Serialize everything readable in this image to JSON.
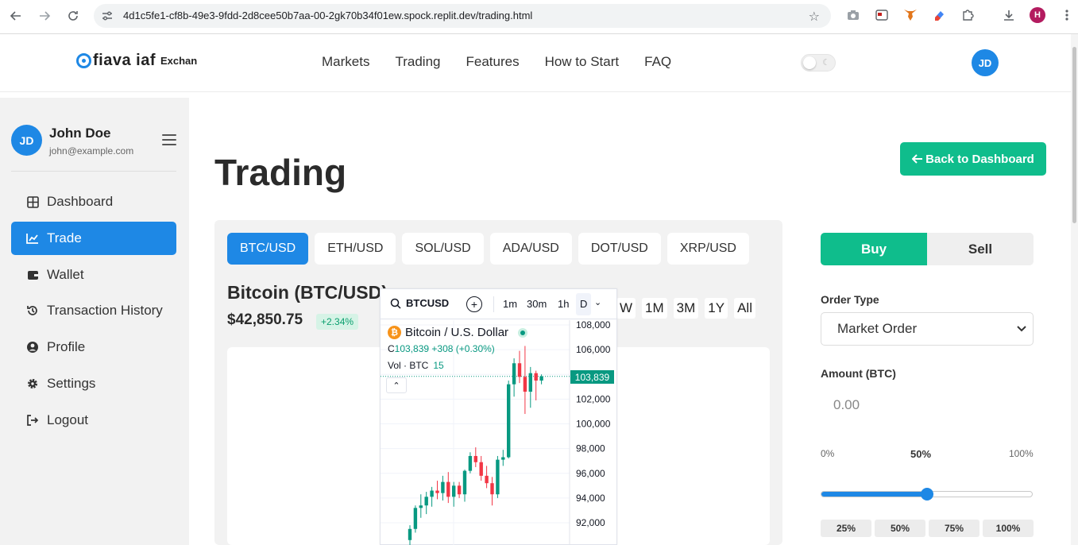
{
  "browser": {
    "url": "4d1c5fe1-cf8b-49e3-9fdd-2d8cee50b7aa-00-2gk70b34f01ew.spock.replit.dev/trading.html",
    "profile_initial": "H"
  },
  "header": {
    "logo_text": "fiava iaf",
    "logo_sub": "Exchan",
    "nav": [
      "Markets",
      "Trading",
      "Features",
      "How to Start",
      "FAQ"
    ],
    "avatar_initials": "JD"
  },
  "sidebar": {
    "user": {
      "initials": "JD",
      "name": "John Doe",
      "email": "john@example.com"
    },
    "items": [
      {
        "label": "Dashboard",
        "icon": "grid-icon",
        "active": false
      },
      {
        "label": "Trade",
        "icon": "chart-line-icon",
        "active": true
      },
      {
        "label": "Wallet",
        "icon": "wallet-icon",
        "active": false
      },
      {
        "label": "Transaction History",
        "icon": "history-icon",
        "active": false
      },
      {
        "label": "Profile",
        "icon": "user-circle-icon",
        "active": false
      },
      {
        "label": "Settings",
        "icon": "gear-icon",
        "active": false
      },
      {
        "label": "Logout",
        "icon": "logout-icon",
        "active": false
      }
    ]
  },
  "main": {
    "title": "Trading",
    "back_button": "Back to Dashboard",
    "pairs": [
      "BTC/USD",
      "ETH/USD",
      "SOL/USD",
      "ADA/USD",
      "DOT/USD",
      "XRP/USD"
    ],
    "active_pair": "BTC/USD",
    "asset_name": "Bitcoin (BTC/USD)",
    "asset_price": "$42,850.75",
    "asset_change": "+2.34%",
    "ranges": [
      "W",
      "1M",
      "3M",
      "1Y",
      "All"
    ]
  },
  "widget": {
    "symbol": "BTCUSD",
    "intervals": [
      "1m",
      "30m",
      "1h",
      "D"
    ],
    "active_interval": "D",
    "title": "Bitcoin / U.S. Dollar",
    "btc_glyph": "₿",
    "ohlc_prefix": "C",
    "ohlc_close": "103,839",
    "ohlc_change": "+308 (+0.30%)",
    "vol_label": "Vol · BTC",
    "vol_value": "15",
    "current_price_label": "103,839",
    "colors": {
      "up": "#089981",
      "down": "#f23645"
    }
  },
  "chart_data": {
    "type": "candlestick",
    "y_ticks": [
      108000,
      106000,
      104000,
      102000,
      100000,
      98000,
      96000,
      94000,
      92000
    ],
    "y_tick_labels": [
      "108,000",
      "106,000",
      "",
      "102,000",
      "100,000",
      "98,000",
      "96,000",
      "94,000",
      "92,000"
    ],
    "last_price": 103839,
    "candles": [
      {
        "o": 90600,
        "h": 91800,
        "l": 90000,
        "c": 91500
      },
      {
        "o": 91500,
        "h": 93400,
        "l": 91200,
        "c": 93200
      },
      {
        "o": 93200,
        "h": 94300,
        "l": 92400,
        "c": 93400
      },
      {
        "o": 93400,
        "h": 94500,
        "l": 92700,
        "c": 94100
      },
      {
        "o": 94100,
        "h": 94900,
        "l": 93300,
        "c": 94600
      },
      {
        "o": 94600,
        "h": 95400,
        "l": 93900,
        "c": 94400
      },
      {
        "o": 94400,
        "h": 95800,
        "l": 93800,
        "c": 95300
      },
      {
        "o": 95300,
        "h": 96100,
        "l": 93600,
        "c": 94100
      },
      {
        "o": 94100,
        "h": 95300,
        "l": 93300,
        "c": 95000
      },
      {
        "o": 95000,
        "h": 95300,
        "l": 94000,
        "c": 94300
      },
      {
        "o": 94300,
        "h": 96300,
        "l": 93700,
        "c": 96200
      },
      {
        "o": 96200,
        "h": 97700,
        "l": 96000,
        "c": 97400
      },
      {
        "o": 97400,
        "h": 98100,
        "l": 96500,
        "c": 96900
      },
      {
        "o": 96900,
        "h": 97400,
        "l": 95400,
        "c": 95800
      },
      {
        "o": 95800,
        "h": 96600,
        "l": 94800,
        "c": 95200
      },
      {
        "o": 95200,
        "h": 95700,
        "l": 93400,
        "c": 94300
      },
      {
        "o": 94300,
        "h": 97400,
        "l": 94000,
        "c": 97100
      },
      {
        "o": 97100,
        "h": 97900,
        "l": 96600,
        "c": 97300
      },
      {
        "o": 97300,
        "h": 103500,
        "l": 97200,
        "c": 103200
      },
      {
        "o": 103200,
        "h": 105300,
        "l": 102200,
        "c": 104900
      },
      {
        "o": 104900,
        "h": 105900,
        "l": 103300,
        "c": 103800
      },
      {
        "o": 103800,
        "h": 106300,
        "l": 100800,
        "c": 102600
      },
      {
        "o": 102600,
        "h": 104600,
        "l": 101300,
        "c": 104100
      },
      {
        "o": 104100,
        "h": 104300,
        "l": 101900,
        "c": 103500
      },
      {
        "o": 103500,
        "h": 104000,
        "l": 103200,
        "c": 103839
      }
    ]
  },
  "order": {
    "tabs": [
      "Buy",
      "Sell"
    ],
    "active_tab": "Buy",
    "order_type_label": "Order Type",
    "order_type_value": "Market Order",
    "amount_label": "Amount (BTC)",
    "amount_placeholder": "0.00",
    "scale_min": "0%",
    "scale_mid": "50%",
    "scale_max": "100%",
    "slider_fraction": 0.5,
    "quick_pcts": [
      "25%",
      "50%",
      "75%",
      "100%"
    ],
    "colors": {
      "buy": "#0fbd8c",
      "accent": "#1e88e5"
    }
  }
}
